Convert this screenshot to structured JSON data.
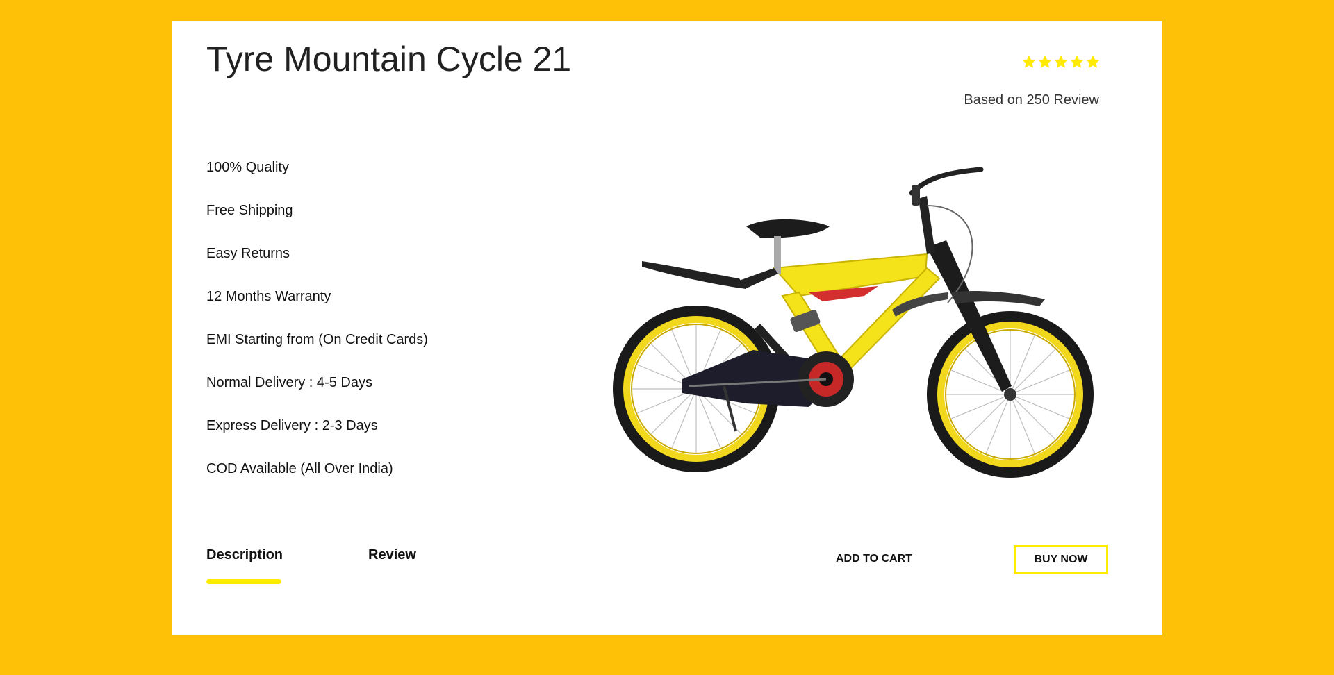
{
  "product": {
    "title": "Tyre Mountain Cycle 21",
    "rating": 5,
    "rating_max": 5,
    "review_text": "Based on 250 Review",
    "image_alt": "yellow mountain bicycle"
  },
  "features": [
    "100% Quality",
    "Free Shipping",
    "Easy Returns",
    "12 Months Warranty",
    "EMI Starting from (On Credit Cards)",
    "Normal Delivery : 4-5 Days",
    "Express Delivery : 2-3 Days",
    "COD Available (All Over India)"
  ],
  "tabs": [
    {
      "label": "Description",
      "active": true
    },
    {
      "label": "Review",
      "active": false
    }
  ],
  "actions": {
    "add_to_cart": "ADD TO CART",
    "buy_now": "BUY NOW"
  },
  "colors": {
    "background": "#ffc107",
    "accent": "#ffeb00",
    "card": "#ffffff",
    "text": "#212121"
  },
  "icons": {
    "star": "star-icon"
  }
}
